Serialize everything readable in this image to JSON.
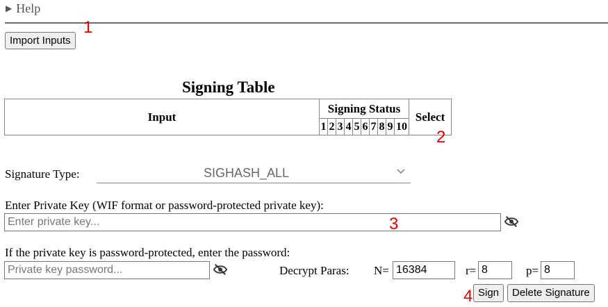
{
  "help": {
    "label": "Help"
  },
  "import_button": "Import Inputs",
  "markers": [
    "1",
    "2",
    "3",
    "4"
  ],
  "signing_table": {
    "title": "Signing Table",
    "col_input": "Input",
    "col_status": "Signing Status",
    "col_select": "Select",
    "status_numbers": [
      "1",
      "2",
      "3",
      "4",
      "5",
      "6",
      "7",
      "8",
      "9",
      "10"
    ]
  },
  "signature_type": {
    "label": "Signature Type:",
    "selected": "SIGHASH_ALL"
  },
  "private_key": {
    "label": "Enter Private Key (WIF format or password-protected private key):",
    "placeholder": "Enter private key..."
  },
  "password": {
    "label": "If the private key is password-protected, enter the password:",
    "placeholder": "Private key password..."
  },
  "decrypt": {
    "label": "Decrypt Paras:",
    "n_label": "N=",
    "n_value": "16384",
    "r_label": "r=",
    "r_value": "8",
    "p_label": "p=",
    "p_value": "8"
  },
  "actions": {
    "sign": "Sign",
    "delete": "Delete Signature"
  },
  "icons": [
    "eye-slash-icon",
    "chevron-down-icon",
    "triangle-right-icon"
  ]
}
